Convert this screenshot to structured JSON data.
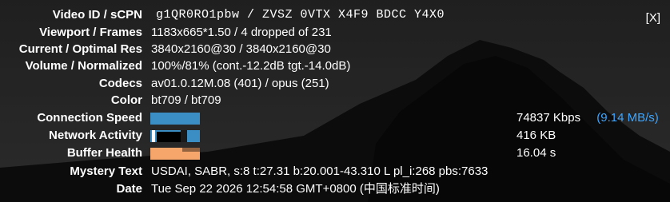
{
  "close_label": "[X]",
  "rows": {
    "video_id": {
      "label": "Video ID / sCPN",
      "value": "g1QR0RO1pbw / ZVSZ 0VTX X4F9 BDCC Y4X0"
    },
    "viewport": {
      "label": "Viewport / Frames",
      "value": "1183x665*1.50 / 4 dropped of 231"
    },
    "res": {
      "label": "Current / Optimal Res",
      "value": "3840x2160@30 / 3840x2160@30"
    },
    "volume": {
      "label": "Volume / Normalized",
      "value": "100%/81% (cont.-12.2dB tgt.-14.0dB)"
    },
    "codecs": {
      "label": "Codecs",
      "value": "av01.0.12M.08 (401) / opus (251)"
    },
    "color": {
      "label": "Color",
      "value": "bt709 / bt709"
    },
    "connection": {
      "label": "Connection Speed",
      "value": "74837 Kbps",
      "value_extra": "(9.14 MB/s)"
    },
    "network": {
      "label": "Network Activity",
      "value": "416 KB"
    },
    "buffer": {
      "label": "Buffer Health",
      "value": "16.04 s"
    },
    "mystery": {
      "label": "Mystery Text",
      "value": "USDAI, SABR, s:8 t:27.31 b:20.001-43.310 L pl_i:268 pbs:7633"
    },
    "date": {
      "label": "Date",
      "value": "Tue Sep 22 2026 12:54:58 GMT+0800 (中国标准时间)"
    }
  },
  "colors": {
    "connection_graph": "#3a8ec4",
    "network_graph": "#3a8ec4",
    "buffer_graph": "#f6a66a",
    "accent": "#3ea6ff"
  }
}
